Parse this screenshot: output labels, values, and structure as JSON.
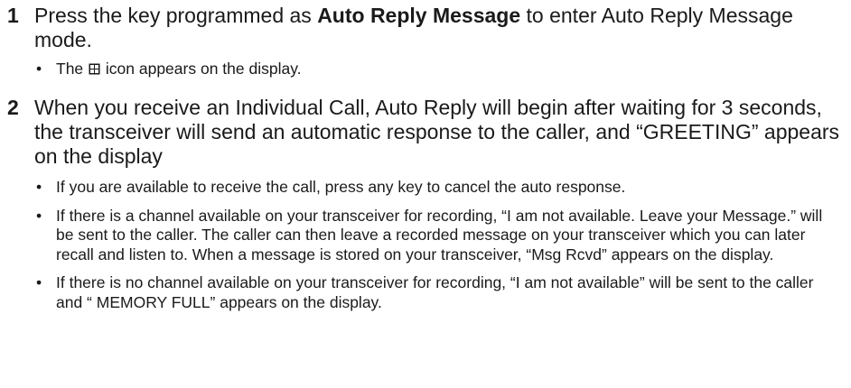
{
  "step1": {
    "number": "1",
    "before": "Press the key programmed as ",
    "bold": "Auto Reply Message",
    "after": " to enter Auto Reply Message mode.",
    "bullet_before": "The ",
    "bullet_icon": "auto-reply-icon",
    "bullet_after": " icon appears on the display."
  },
  "step2": {
    "number": "2",
    "text": "When you receive an Individual Call, Auto Reply will begin after waiting for 3 seconds, the transceiver will send an automatic response to the caller, and “GREETING” appears on the display",
    "bullets": [
      "If you are available to receive the call, press any key to cancel the auto response.",
      "If there is a channel available on your transceiver for recording, “I am not available. Leave your Message.” will be sent to the caller.  The caller can then leave a recorded message on your transceiver which you can later recall and listen to.  When a message is stored on your transceiver, “Msg Rcvd” appears on the display.",
      "If there is no channel available on your transceiver for recording, “I am not available” will be sent to the caller and “ MEMORY FULL” appears on the display."
    ]
  }
}
